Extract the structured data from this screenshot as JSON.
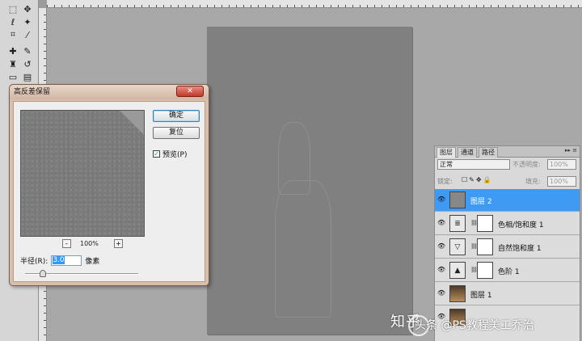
{
  "dialog": {
    "title": "高反差保留",
    "close_label": "✕",
    "ok_label": "确定",
    "reset_label": "复位",
    "preview_label": "预览(P)",
    "preview_checked": true,
    "zoom_out": "-",
    "zoom_in": "+",
    "zoom_level": "100%",
    "radius_label": "半径(R):",
    "radius_value": "3.0",
    "radius_unit": "像素"
  },
  "layers_panel": {
    "tabs": [
      "图层",
      "通道",
      "路径"
    ],
    "menu_icon": "▸▸ ≡",
    "blend_mode": "正常",
    "opacity_label": "不透明度:",
    "opacity_value": "100%",
    "lock_label": "锁定:",
    "fill_label": "填充:",
    "fill_value": "100%",
    "layers": [
      {
        "name": "图层 2",
        "selected": true,
        "thumb": "gray"
      },
      {
        "name": "色相/饱和度 1",
        "selected": false,
        "thumb": "hue-saturation-icon"
      },
      {
        "name": "自然饱和度 1",
        "selected": false,
        "thumb": "vibrance-icon"
      },
      {
        "name": "色阶 1",
        "selected": false,
        "thumb": "levels-icon"
      },
      {
        "name": "图层 1",
        "selected": false,
        "thumb": "photo"
      }
    ]
  },
  "watermark": {
    "main": "知乎",
    "sub": "头条 @PS教程美工乔治"
  },
  "colors": {
    "selected_layer": "#3f9af4",
    "canvas": "#808080",
    "dialog_frame": "#d7bfae"
  }
}
